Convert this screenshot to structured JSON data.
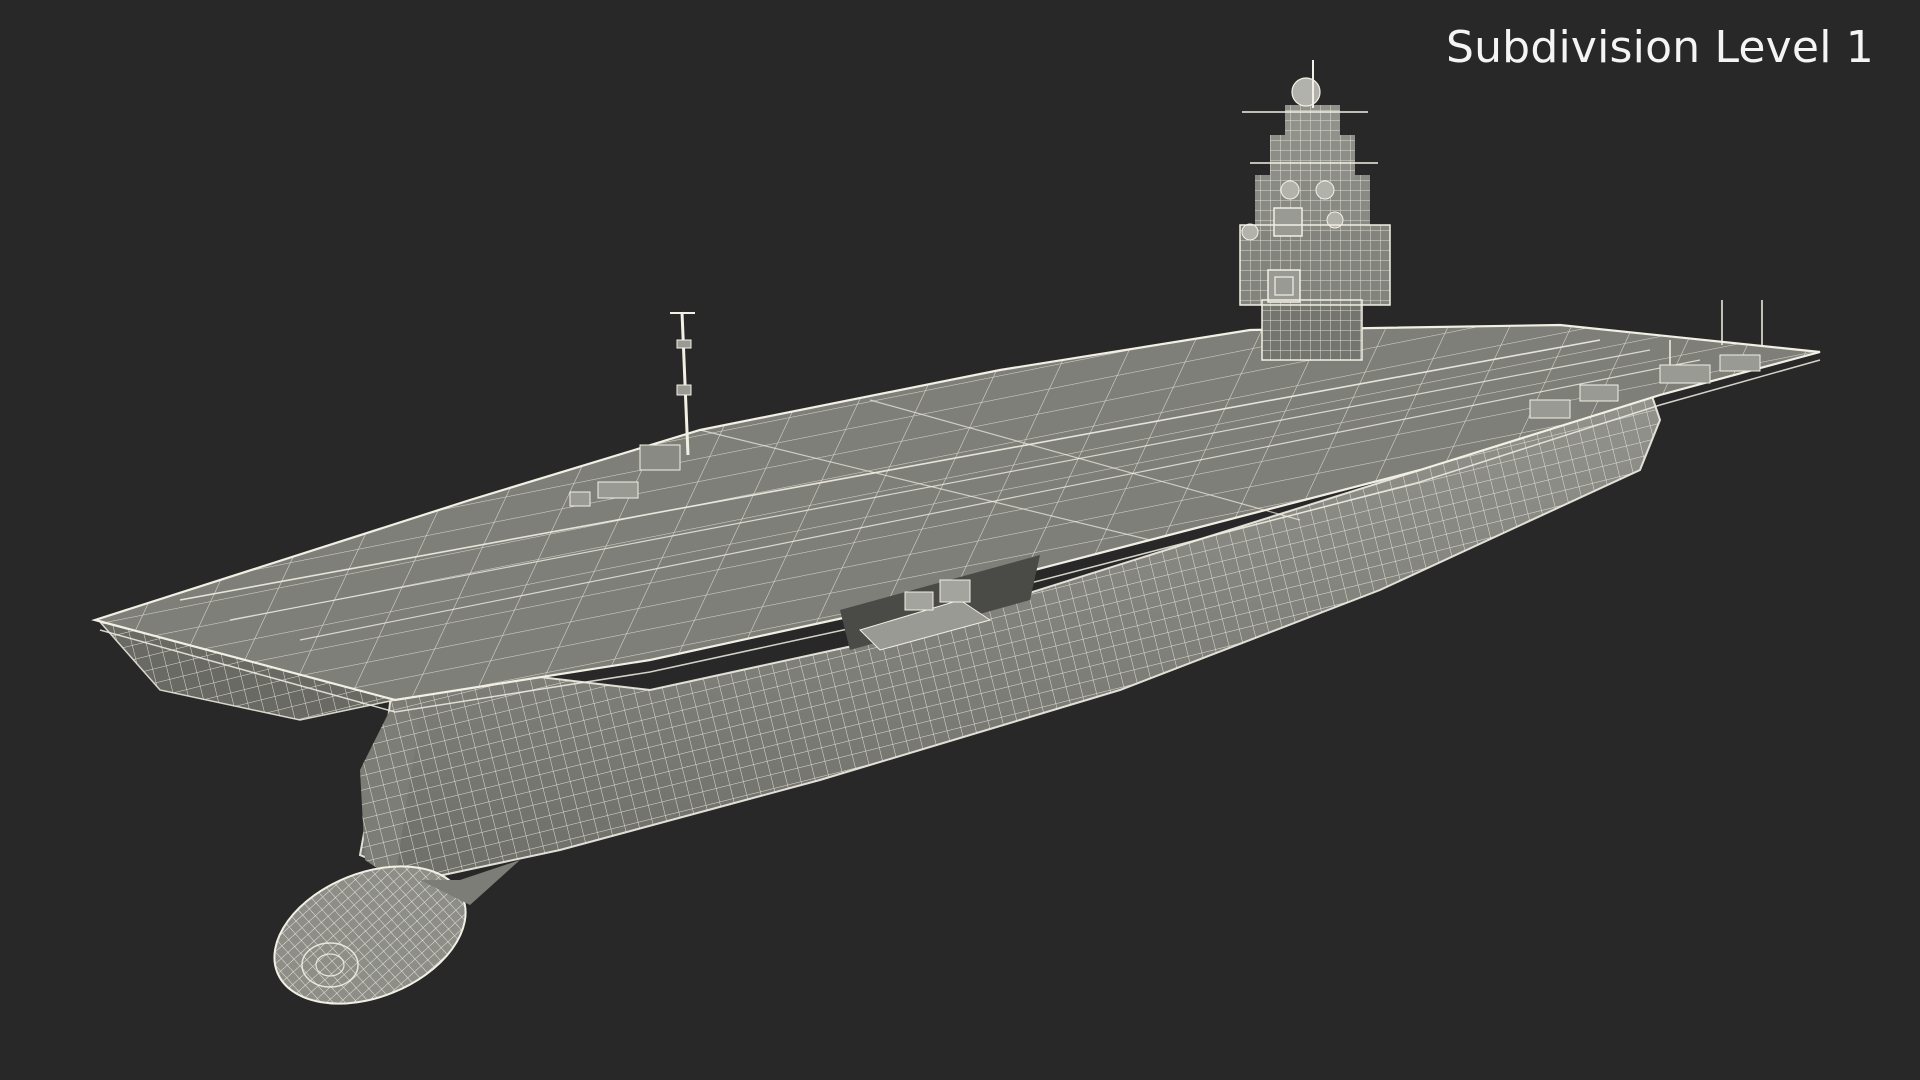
{
  "viewport": {
    "background": "#282828",
    "label": "Subdivision Level 1"
  },
  "model": {
    "hull_color": "#8a8a84",
    "hull_shadow": "#5e5e59",
    "deck_color": "#7d7d77",
    "wire_color": "#f2f0e4"
  }
}
